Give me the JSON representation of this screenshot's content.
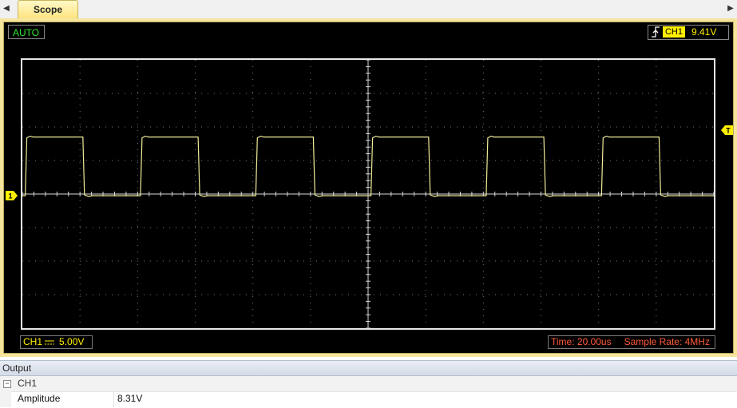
{
  "tabs": {
    "active": "Scope"
  },
  "scope": {
    "mode": "AUTO",
    "trigger": {
      "channel": "CH1",
      "level": "9.41V",
      "edge": "rising"
    },
    "markers": {
      "channel_marker": "1",
      "trigger_marker": "T"
    },
    "status": {
      "channel": "CH1",
      "volts_per_div": "5.00V",
      "time": "Time: 20.00us",
      "sample_rate": "Sample Rate: 4MHz"
    },
    "colors": {
      "trace": "#f2ec9a",
      "accent": "#ffef00",
      "mode": "#31e631",
      "timing": "#ff5a3a",
      "frame": "#f4e49c"
    },
    "waveform": {
      "shape": "square",
      "high_div": 1.7,
      "low_div": -0.05,
      "period_div": 2.0,
      "duty": 0.5,
      "first_rising_edge_div": -1.95
    }
  },
  "output": {
    "title": "Output",
    "group": "CH1",
    "properties": [
      {
        "name": "Amplitude",
        "value": "8.31V"
      }
    ]
  }
}
